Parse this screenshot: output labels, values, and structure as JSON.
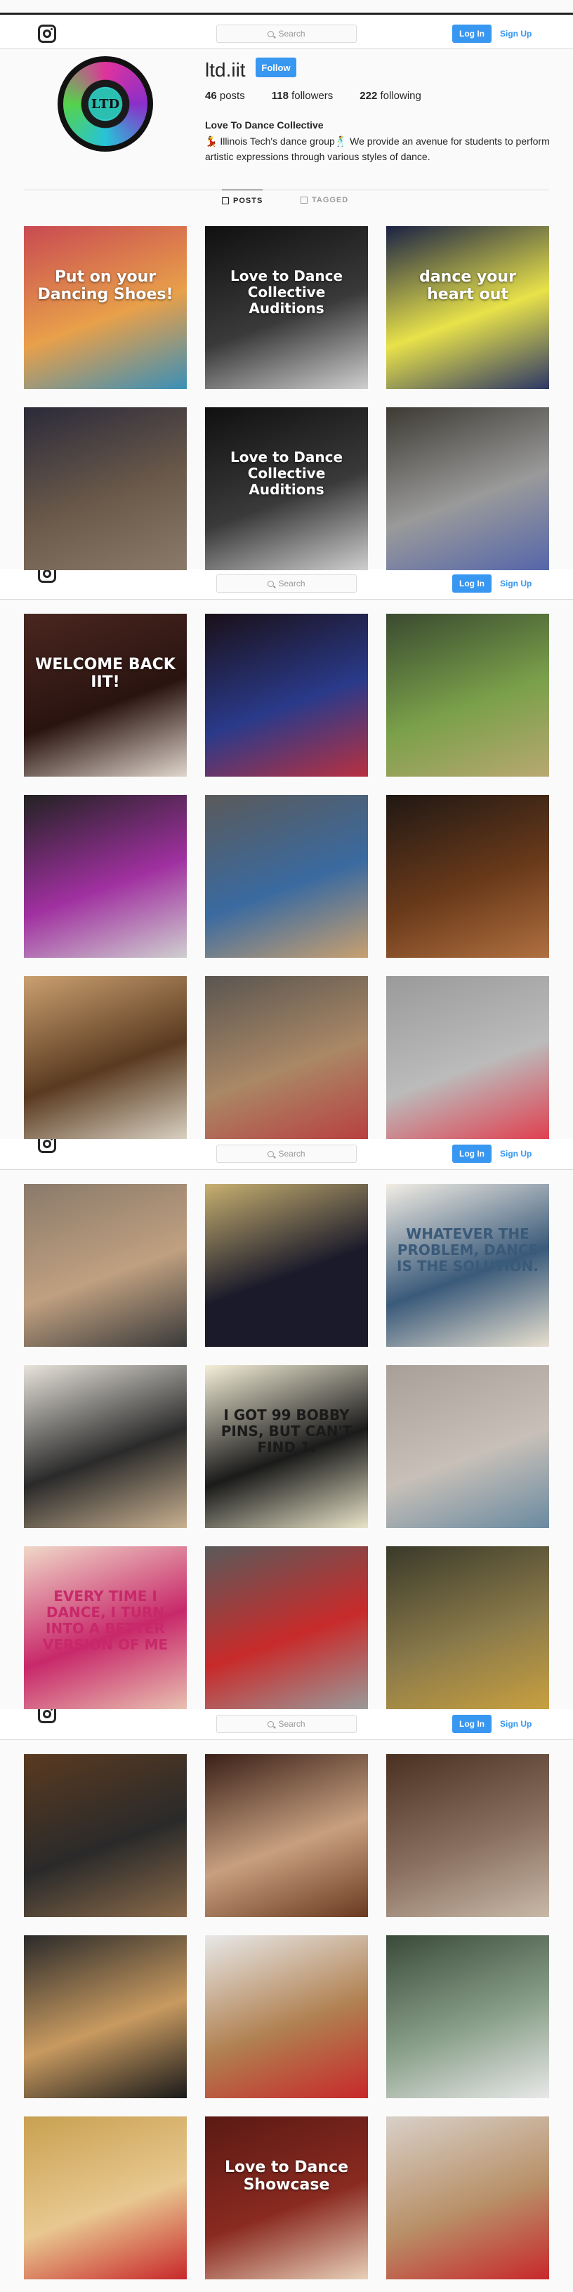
{
  "header": {
    "search_placeholder": "Search",
    "login_label": "Log In",
    "signup_label": "Sign Up"
  },
  "profile": {
    "avatar_text": "LTD",
    "username": "ltd.iit",
    "follow_label": "Follow",
    "posts_count": "46",
    "posts_label": "posts",
    "followers_count": "118",
    "followers_label": "followers",
    "following_count": "222",
    "following_label": "following",
    "bio_name": "Love To Dance Collective",
    "bio_text": "💃 Illinois Tech's dance group🕺 We provide an avenue for students to perform artistic expressions through various styles of dance."
  },
  "tabs": {
    "posts": "POSTS",
    "tagged": "TAGGED"
  },
  "posts": [
    {
      "caption": "Put on your Dancing Shoes!",
      "colors": [
        "#c94a52",
        "#e8a04a",
        "#3a8fb8"
      ]
    },
    {
      "caption": "Love to Dance Collective Auditions",
      "colors": [
        "#101010",
        "#3a3a3a",
        "#cfcfcf"
      ]
    },
    {
      "caption": "dance your heart out",
      "colors": [
        "#1a2244",
        "#e8e24a",
        "#2c3766"
      ]
    },
    {
      "caption": "",
      "colors": [
        "#2b2a3a",
        "#6b5a4a",
        "#8a7a6a"
      ]
    },
    {
      "caption": "Love to Dance Collective Auditions",
      "colors": [
        "#101010",
        "#3a3a3a",
        "#cfcfcf"
      ]
    },
    {
      "caption": "",
      "colors": [
        "#3d3a33",
        "#9a9a9a",
        "#5566aa"
      ]
    },
    {
      "caption": "WELCOME BACK IIT!",
      "colors": [
        "#4a2620",
        "#2a1410",
        "#e0d6cc"
      ]
    },
    {
      "caption": "",
      "colors": [
        "#1a1018",
        "#2a3a8a",
        "#b83040"
      ]
    },
    {
      "caption": "",
      "colors": [
        "#3a4a30",
        "#7aa04a",
        "#b8a870"
      ]
    },
    {
      "caption": "",
      "colors": [
        "#222",
        "#a030a0",
        "#cfcfcf"
      ]
    },
    {
      "caption": "",
      "colors": [
        "#5a5a5a",
        "#3a6aa0",
        "#c8a070"
      ]
    },
    {
      "caption": "",
      "colors": [
        "#201814",
        "#6a3a1a",
        "#b07040"
      ]
    },
    {
      "caption": "",
      "colors": [
        "#caa070",
        "#5a3a20",
        "#d8d0c0"
      ]
    },
    {
      "caption": "",
      "colors": [
        "#5a5550",
        "#aa8866",
        "#b84040"
      ]
    },
    {
      "caption": "",
      "colors": [
        "#9a9a9a",
        "#bbbbbb",
        "#e04050"
      ]
    },
    {
      "caption": "",
      "colors": [
        "#8a7a6a",
        "#c0a080",
        "#3a3a3a"
      ]
    },
    {
      "caption": "",
      "colors": [
        "#c8b070",
        "#1a1a2a",
        "#1a1a2a"
      ]
    },
    {
      "caption": "WHATEVER THE PROBLEM, DANCE IS THE SOLUTION.",
      "colors": [
        "#f2ede4",
        "#3a5a7a",
        "#e8e0d0"
      ]
    },
    {
      "caption": "",
      "colors": [
        "#e8e4dc",
        "#2a2a2a",
        "#c8b090"
      ]
    },
    {
      "caption": "I GOT 99 BOBBY PINS, BUT CAN'T FIND 1.",
      "colors": [
        "#f4efd8",
        "#1a1a1a",
        "#e8e4c8"
      ]
    },
    {
      "caption": "",
      "colors": [
        "#a8a098",
        "#c8c0b8",
        "#6a8aa0"
      ]
    },
    {
      "caption": "EVERY TIME I DANCE, I TURN INTO A BETTER VERSION OF ME",
      "colors": [
        "#f0d8c8",
        "#c8286a",
        "#e8c0b0"
      ]
    },
    {
      "caption": "",
      "colors": [
        "#5a5a5a",
        "#c82a2a",
        "#9a9a9a"
      ]
    },
    {
      "caption": "",
      "colors": [
        "#3a3a2a",
        "#8a7a4a",
        "#c8a040"
      ]
    },
    {
      "caption": "",
      "colors": [
        "#5a3a20",
        "#2a2a2a",
        "#8a6a4a"
      ]
    },
    {
      "caption": "",
      "colors": [
        "#3a2018",
        "#c8a080",
        "#6a3a20"
      ]
    },
    {
      "caption": "",
      "colors": [
        "#4a3020",
        "#8a7060",
        "#c8b8a8"
      ]
    },
    {
      "caption": "",
      "colors": [
        "#2a2a2a",
        "#c89a60",
        "#1a1a1a"
      ]
    },
    {
      "caption": "",
      "colors": [
        "#e8e8e8",
        "#b08050",
        "#c8282a"
      ]
    },
    {
      "caption": "",
      "colors": [
        "#3a4a3a",
        "#8aa08a",
        "#e8e8e8"
      ]
    },
    {
      "caption": "",
      "colors": [
        "#c8a050",
        "#e8c890",
        "#c8282a"
      ]
    },
    {
      "caption": "Love to Dance Showcase",
      "colors": [
        "#5a1a14",
        "#8a2a20",
        "#e8d0b8"
      ]
    },
    {
      "caption": "",
      "colors": [
        "#d8d0c8",
        "#b89068",
        "#c8282a"
      ]
    }
  ],
  "colors": {
    "accent": "#3897f0",
    "text": "#262626",
    "muted": "#999999",
    "border": "#dbdbdb",
    "background": "#fafafa"
  }
}
